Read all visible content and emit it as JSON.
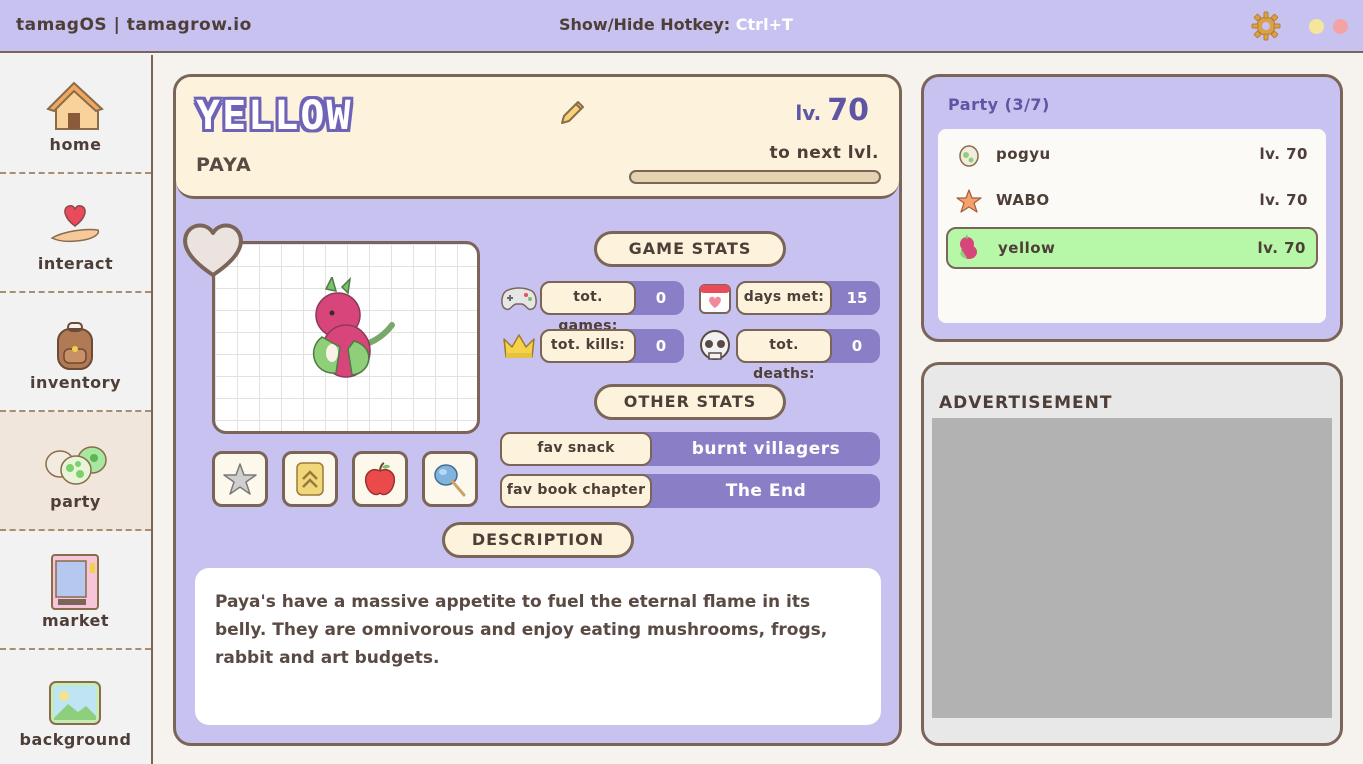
{
  "window": {
    "title": "tamagOS | tamagrow.io",
    "hotkey_label": "Show/Hide Hotkey:",
    "hotkey_value": "Ctrl+T"
  },
  "sidebar": {
    "items": [
      {
        "label": "home",
        "icon": "house-icon"
      },
      {
        "label": "interact",
        "icon": "heart-hand-icon"
      },
      {
        "label": "inventory",
        "icon": "backpack-icon"
      },
      {
        "label": "party",
        "icon": "eggs-icon",
        "active": true
      },
      {
        "label": "market",
        "icon": "vending-machine-icon"
      },
      {
        "label": "background",
        "icon": "picture-icon"
      }
    ]
  },
  "pet": {
    "name": "YELLOW",
    "species": "PAYA",
    "level_label": "lv.",
    "level": "70",
    "next_label": "to next lvl.",
    "xp_progress": 0.0
  },
  "game_stats": {
    "title": "GAME STATS",
    "items": [
      {
        "icon": "gamepad-icon",
        "label": "tot. games:",
        "value": "0"
      },
      {
        "icon": "calendar-icon",
        "label": "days met:",
        "value": "15"
      },
      {
        "icon": "crown-icon",
        "label": "tot. kills:",
        "value": "0"
      },
      {
        "icon": "skull-icon",
        "label": "tot. deaths:",
        "value": "0"
      }
    ]
  },
  "other_stats": {
    "title": "OTHER STATS",
    "items": [
      {
        "label": "fav snack",
        "value": "burnt villagers"
      },
      {
        "label": "fav book chapter",
        "value": "The End"
      }
    ]
  },
  "description": {
    "title": "DESCRIPTION",
    "text": "Paya's have a massive appetite to fuel the eternal flame in its belly. They are omnivorous and enjoy eating mushrooms, frogs, rabbit and art budgets."
  },
  "actions": [
    "star-icon",
    "rank-up-icon",
    "apple-icon",
    "food-skewer-icon"
  ],
  "party": {
    "title": "Party (3/7)",
    "members": [
      {
        "name": "pogyu",
        "level": "lv. 70",
        "icon": "egg-icon"
      },
      {
        "name": "WABO",
        "level": "lv. 70",
        "icon": "star-pet-icon"
      },
      {
        "name": "yellow",
        "level": "lv. 70",
        "icon": "dragon-pet-icon",
        "selected": true
      }
    ]
  },
  "advertisement": {
    "title": "ADVERTISEMENT"
  },
  "colors": {
    "lavender": "#c8c2f0",
    "accent": "#8a7fc7",
    "cream": "#fdf3dc",
    "border": "#7a6558",
    "selected": "#b7f7a8"
  }
}
